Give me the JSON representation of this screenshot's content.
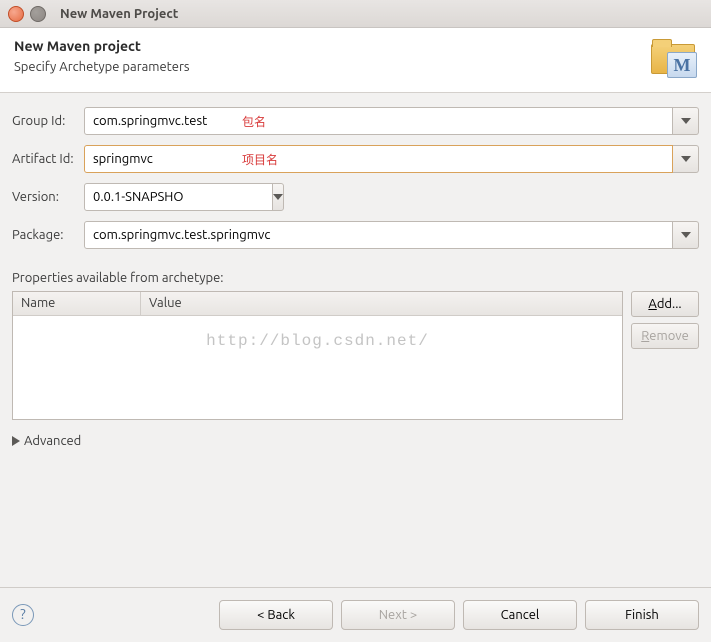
{
  "window": {
    "title": "New Maven Project"
  },
  "header": {
    "title": "New Maven project",
    "subtitle": "Specify Archetype parameters"
  },
  "form": {
    "group_id": {
      "label": "Group Id:",
      "value": "com.springmvc.test",
      "annotation": "包名"
    },
    "artifact_id": {
      "label": "Artifact Id:",
      "value": "springmvc",
      "annotation": "项目名"
    },
    "version": {
      "label": "Version:",
      "value": "0.0.1-SNAPSHO"
    },
    "package": {
      "label": "Package:",
      "value": "com.springmvc.test.springmvc"
    }
  },
  "properties": {
    "section_label": "Properties available from archetype:",
    "columns": {
      "name": "Name",
      "value": "Value"
    },
    "add_label": "Add...",
    "remove_label": "Remove"
  },
  "watermark": "http://blog.csdn.net/",
  "advanced": {
    "label": "Advanced"
  },
  "footer": {
    "back": "< Back",
    "next": "Next >",
    "cancel": "Cancel",
    "finish": "Finish"
  }
}
